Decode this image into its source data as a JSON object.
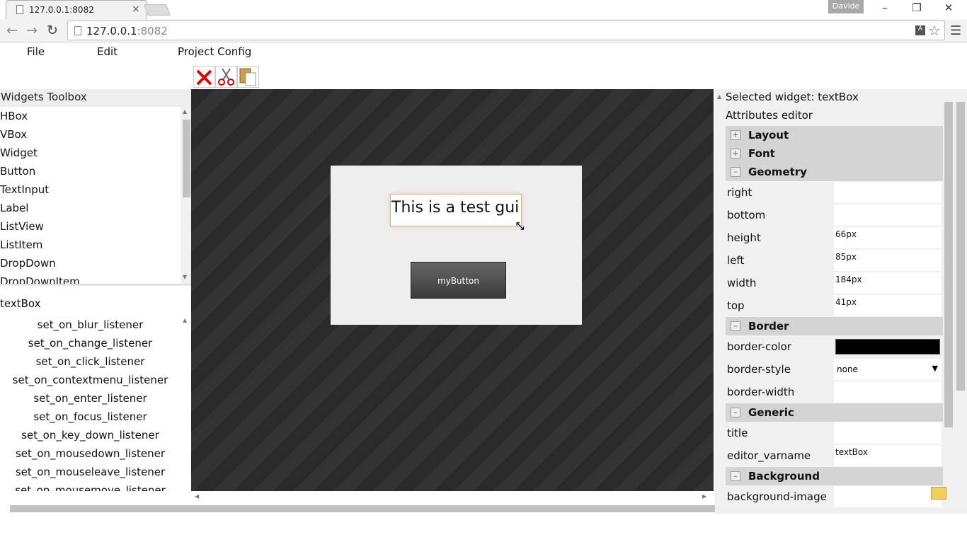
{
  "browser": {
    "tab_title": "127.0.0.1:8082",
    "tab_close": "×",
    "user": "Davide",
    "url_host": "127.0.0.1",
    "url_port": ":8082",
    "win_minimize": "–",
    "win_restore": "❐",
    "win_close": "✕"
  },
  "menu": {
    "file": "File",
    "edit": "Edit",
    "project_config": "Project Config"
  },
  "toolbox": {
    "title": "Widgets Toolbox",
    "items": [
      "HBox",
      "VBox",
      "Widget",
      "Button",
      "TextInput",
      "Label",
      "ListView",
      "ListItem",
      "DropDown",
      "DropDownItem"
    ]
  },
  "instance": {
    "name": "textBox",
    "listeners": [
      "set_on_blur_listener",
      "set_on_change_listener",
      "set_on_click_listener",
      "set_on_contextmenu_listener",
      "set_on_enter_listener",
      "set_on_focus_listener",
      "set_on_key_down_listener",
      "set_on_mousedown_listener",
      "set_on_mouseleave_listener",
      "set_on_mousemove_listener"
    ]
  },
  "canvas": {
    "textbox_text": "This is a test gui",
    "button_label": "myButton"
  },
  "attributes": {
    "selected_widget": "Selected widget: textBox",
    "title": "Attributes editor",
    "groups": {
      "layout": "Layout",
      "font": "Font",
      "geometry": "Geometry",
      "border": "Border",
      "generic": "Generic",
      "background": "Background"
    },
    "geometry_rows": [
      {
        "label": "right",
        "value": ""
      },
      {
        "label": "bottom",
        "value": ""
      },
      {
        "label": "height",
        "value": "66px"
      },
      {
        "label": "left",
        "value": "85px"
      },
      {
        "label": "width",
        "value": "184px"
      },
      {
        "label": "top",
        "value": "41px"
      }
    ],
    "border_color_label": "border-color",
    "border_color_value": "#000000",
    "border_style_label": "border-style",
    "border_style_value": "none",
    "border_width_label": "border-width",
    "border_width_value": "",
    "generic_title_label": "title",
    "generic_title_value": "",
    "editor_varname_label": "editor_varname",
    "editor_varname_value": "textBox",
    "background_image_label": "background-image"
  }
}
